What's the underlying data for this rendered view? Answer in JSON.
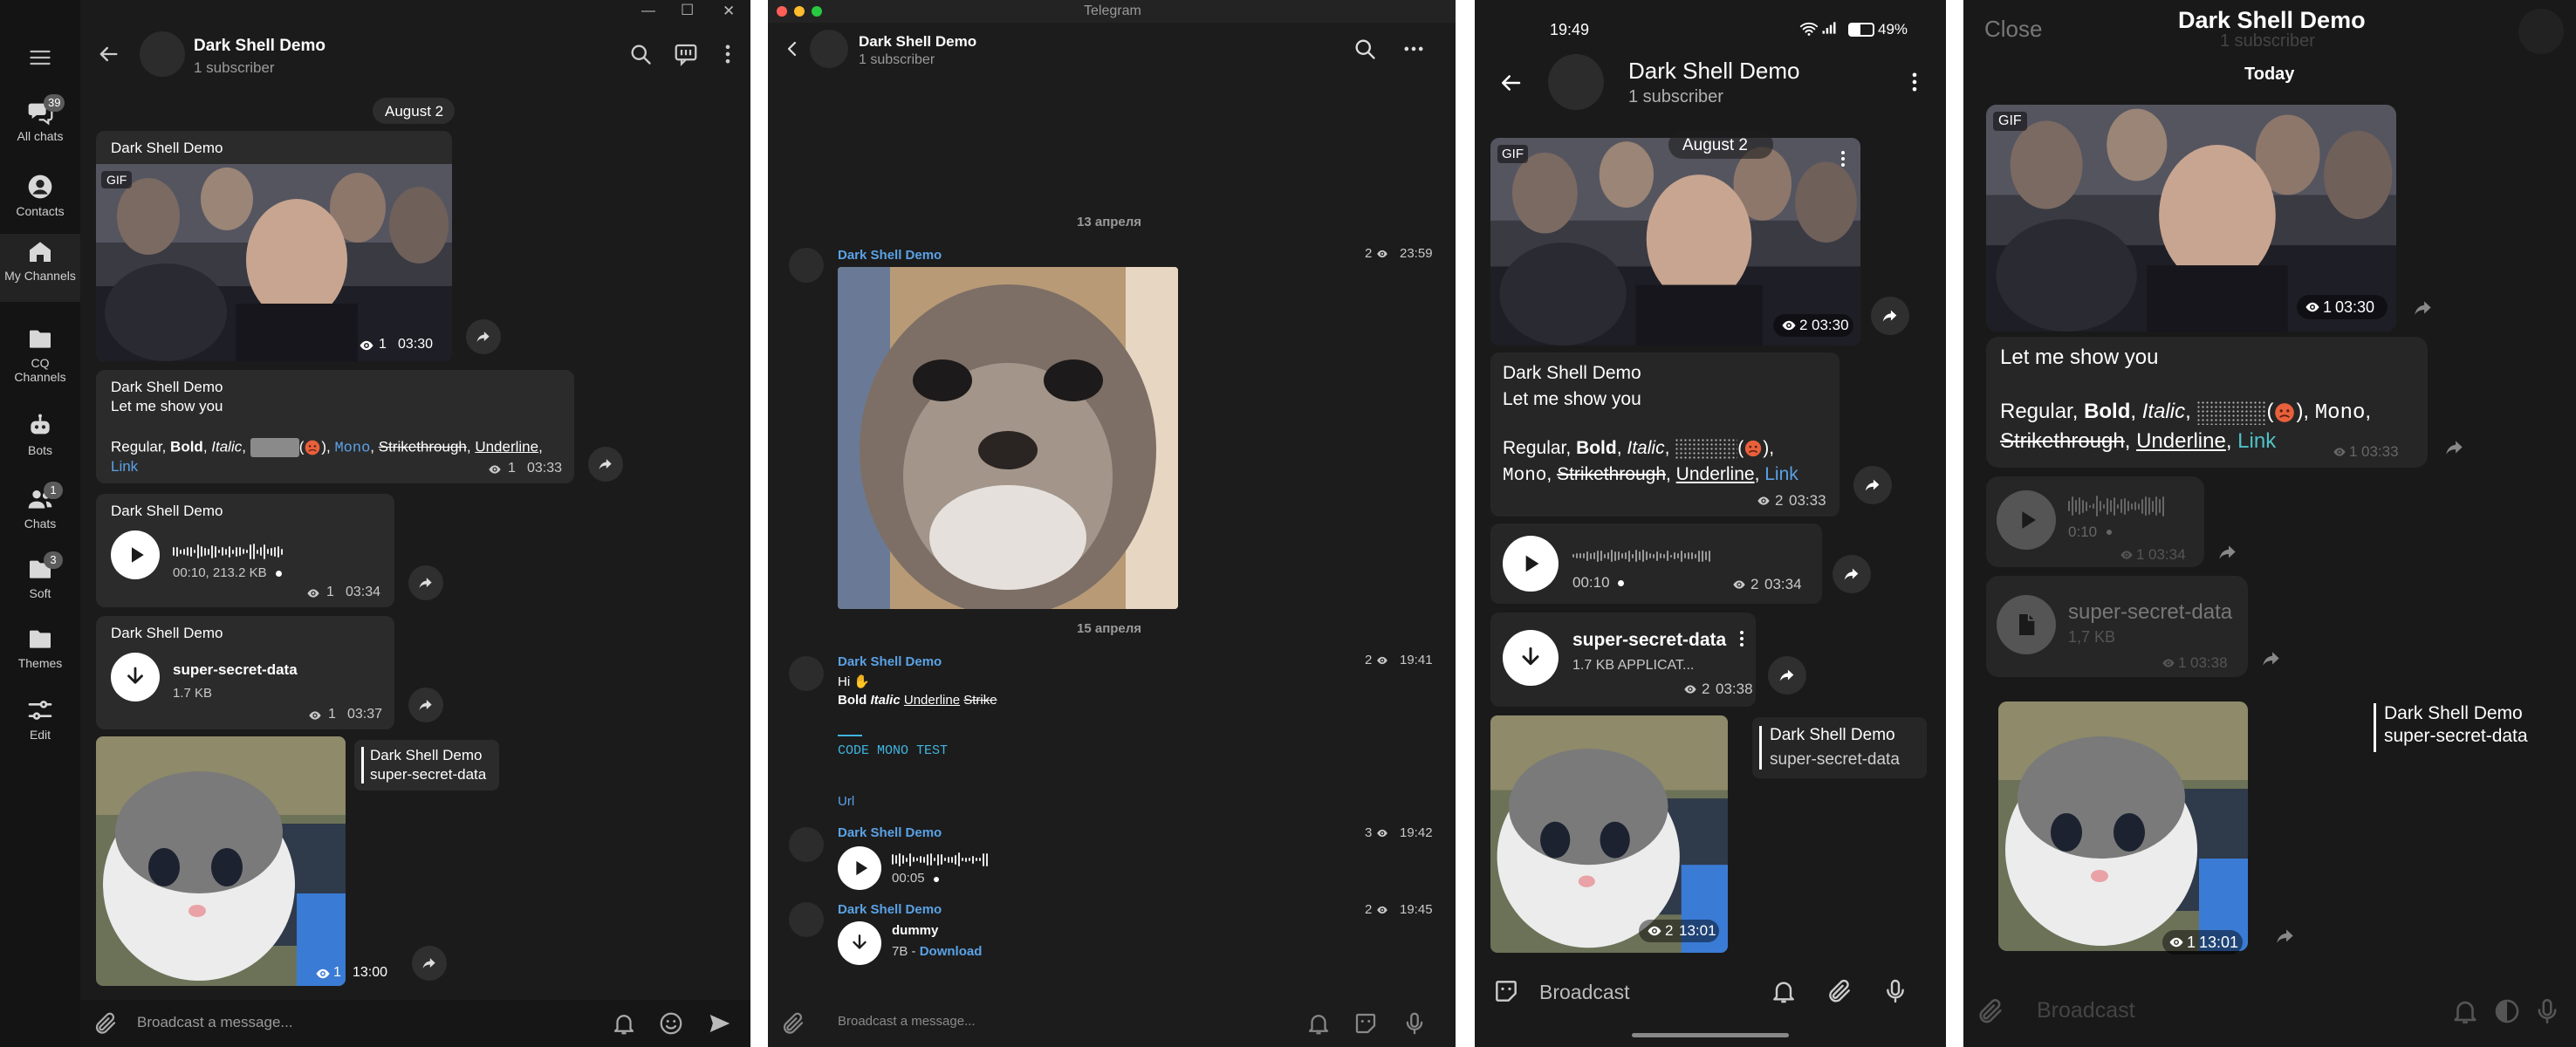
{
  "desktop": {
    "window_controls": {
      "minimize": "—",
      "maximize": "☐",
      "close": "✕"
    },
    "nav": [
      {
        "label": "All chats",
        "badge": "39",
        "icon": "chats-icon"
      },
      {
        "label": "Contacts",
        "badge": "",
        "icon": "user-icon"
      },
      {
        "label": "My Channels",
        "badge": "",
        "icon": "home-icon"
      },
      {
        "label": "CQ Channels",
        "badge": "",
        "icon": "folder-icon"
      },
      {
        "label": "Bots",
        "badge": "",
        "icon": "bot-icon"
      },
      {
        "label": "Chats",
        "badge": "1",
        "icon": "people-icon"
      },
      {
        "label": "Soft",
        "badge": "3",
        "icon": "folder-icon"
      },
      {
        "label": "Themes",
        "badge": "",
        "icon": "folder-icon"
      },
      {
        "label": "Edit",
        "badge": "",
        "icon": "sliders-icon"
      }
    ],
    "header": {
      "title": "Dark Shell Demo",
      "subtitle": "1 subscriber"
    },
    "date": "August 2",
    "gif_msg": {
      "sender": "Dark Shell Demo",
      "badge": "GIF",
      "views": "1",
      "time": "03:30"
    },
    "text_msg": {
      "sender": "Dark Shell Demo",
      "line1": "Let me show you",
      "regular": "Regular, ",
      "bold": "Bold",
      "sep1": ", ",
      "italic": "Italic",
      "sep2": ", ",
      "sep3": "(",
      "sep4": "), ",
      "mono": "Mono",
      "sep5": ", ",
      "strike": "Strikethrough",
      "sep6": ", ",
      "underline": "Underline",
      "sep7": ",",
      "link": "Link",
      "views": "1",
      "time": "03:33"
    },
    "voice_msg": {
      "sender": "Dark Shell Demo",
      "info": "00:10, 213.2 KB",
      "views": "1",
      "time": "03:34"
    },
    "file_msg": {
      "sender": "Dark Shell Demo",
      "name": "super-secret-data",
      "size": "1.7 KB",
      "views": "1",
      "time": "03:37"
    },
    "photo_msg": {
      "views": "1",
      "time": "13:00",
      "reply_name": "Dark Shell Demo",
      "reply_text": "super-secret-data"
    },
    "input": {
      "placeholder": "Broadcast a message..."
    }
  },
  "macos": {
    "window_title": "Telegram",
    "header": {
      "title": "Dark Shell Demo",
      "subtitle": "1 subscriber"
    },
    "date1": "13 апреля",
    "msg1": {
      "sender": "Dark Shell Demo",
      "views": "2",
      "time": "23:59"
    },
    "date2": "15 апреля",
    "msg2": {
      "sender": "Dark Shell Demo",
      "hi": "Hi ✋",
      "bold": "Bold",
      "italic": "Italic",
      "underline": "Underline",
      "strike": "Strike",
      "code": "CODE MONO TEST",
      "url": "Url",
      "views": "2",
      "time": "19:41"
    },
    "msg3": {
      "sender": "Dark Shell Demo",
      "duration": "00:05",
      "views": "3",
      "time": "19:42"
    },
    "msg4": {
      "sender": "Dark Shell Demo",
      "name": "dummy",
      "size": "7B",
      "sep": " - ",
      "download": "Download",
      "views": "2",
      "time": "19:45"
    },
    "input": {
      "placeholder": "Broadcast a message..."
    }
  },
  "android": {
    "status": {
      "time": "19:49",
      "battery": "49%"
    },
    "header": {
      "title": "Dark Shell Demo",
      "subtitle": "1 subscriber"
    },
    "date": "August 2",
    "gif_msg": {
      "badge": "GIF",
      "views": "2",
      "time": "03:30"
    },
    "text_msg": {
      "sender": "Dark Shell Demo",
      "line1": "Let me show you",
      "regular": "Regular, ",
      "bold": "Bold",
      "sep1": ", ",
      "italic": "Italic",
      "sep2": ", ",
      "sep3": "(",
      "sep4": "),",
      "mono": "Mono",
      "sep5": ", ",
      "strike": "Strikethrough",
      "sep6": ", ",
      "underline": "Underline",
      "sep7": ", ",
      "link": "Link",
      "views": "2",
      "time": "03:33"
    },
    "voice_msg": {
      "duration": "00:10",
      "views": "2",
      "time": "03:34"
    },
    "file_msg": {
      "name": "super-secret-data",
      "info": "1.7 KB APPLICAT...",
      "views": "2",
      "time": "03:38"
    },
    "photo_msg": {
      "views": "2",
      "time": "13:01",
      "reply_name": "Dark Shell Demo",
      "reply_text": "super-secret-data"
    },
    "input": {
      "placeholder": "Broadcast"
    }
  },
  "ios": {
    "close": "Close",
    "header": {
      "title": "Dark Shell Demo",
      "subtitle": "1 subscriber"
    },
    "date": "Today",
    "gif_msg": {
      "badge": "GIF",
      "views": "1",
      "time": "03:30"
    },
    "text_msg": {
      "line1": "Let me show you",
      "regular": "Regular, ",
      "bold": "Bold",
      "sep1": ", ",
      "italic": "Italic",
      "sep2": ", ",
      "sep3": "(",
      "sep4": "), ",
      "mono": "Mono",
      "sep5": ",",
      "strike": "Strikethrough",
      "sep6": ", ",
      "underline": "Underline",
      "sep7": ", ",
      "link": "Link",
      "views": "1",
      "time": "03:33"
    },
    "voice_msg": {
      "duration": "0:10",
      "views": "1",
      "time": "03:34"
    },
    "file_msg": {
      "name": "super-secret-data",
      "size": "1,7 KB",
      "views": "1",
      "time": "03:38"
    },
    "photo_msg": {
      "views": "1",
      "time": "13:01",
      "reply_name": "Dark Shell Demo",
      "reply_text": "super-secret-data"
    },
    "input": {
      "placeholder": "Broadcast"
    }
  }
}
